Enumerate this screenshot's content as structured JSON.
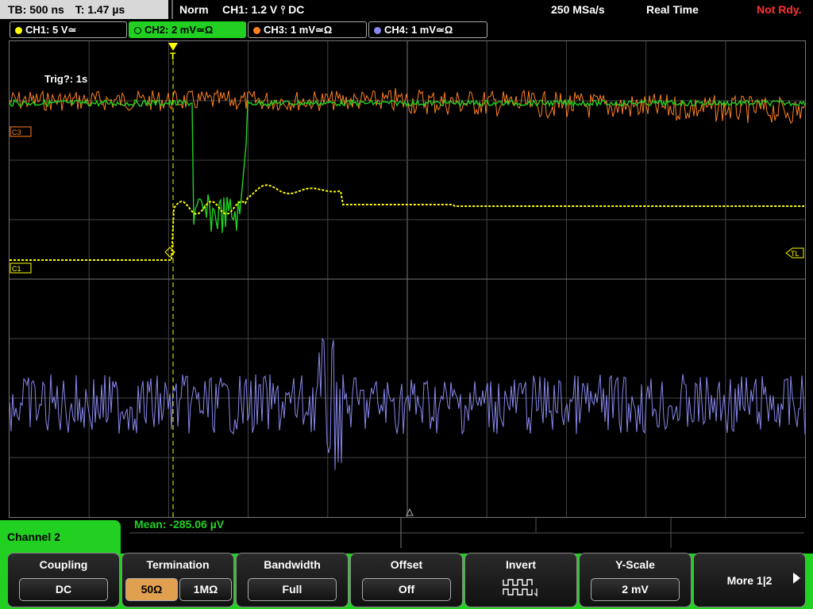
{
  "status_bar": {
    "timebase": "TB: 500 ns",
    "trigger_time": "T: 1.47 µs",
    "mode": "Norm",
    "trigger_setting": "CH1: 1.2 V ⫯ DC",
    "sample_rate": "250 MSa/s",
    "acq_mode": "Real Time",
    "ready_state": "Not Rdy."
  },
  "channels": [
    {
      "label": "CH1: 5 V≃",
      "color": "#ffff00",
      "active": false
    },
    {
      "label": "CH2: 2 mV≃Ω",
      "color": "#22d022",
      "active": true
    },
    {
      "label": "CH3: 1 mV≃Ω",
      "color": "#ff8020",
      "active": false
    },
    {
      "label": "CH4: 1 mV≃Ω",
      "color": "#8888ee",
      "active": false
    }
  ],
  "scope": {
    "trig_message": "Trig?: 1s",
    "c1_marker": "C1",
    "c3_marker": "C3",
    "tl_marker": "TL",
    "trigger_marker": "T"
  },
  "measurement": {
    "mean_text": "Mean: -285.06 µV"
  },
  "menu": {
    "title": "Channel 2",
    "coupling_label": "Coupling",
    "coupling_value": "DC",
    "termination_label": "Termination",
    "termination_opt_a": "50Ω",
    "termination_opt_b": "1MΩ",
    "bandwidth_label": "Bandwidth",
    "bandwidth_value": "Full",
    "offset_label": "Offset",
    "offset_value": "Off",
    "invert_label": "Invert",
    "yscale_label": "Y-Scale",
    "yscale_value": "2 mV",
    "more_label": "More 1|2"
  },
  "colors": {
    "ch1": "#ffff00",
    "ch2": "#22d022",
    "ch3": "#ff8020",
    "ch4": "#8888ee",
    "grid": "#555555"
  }
}
